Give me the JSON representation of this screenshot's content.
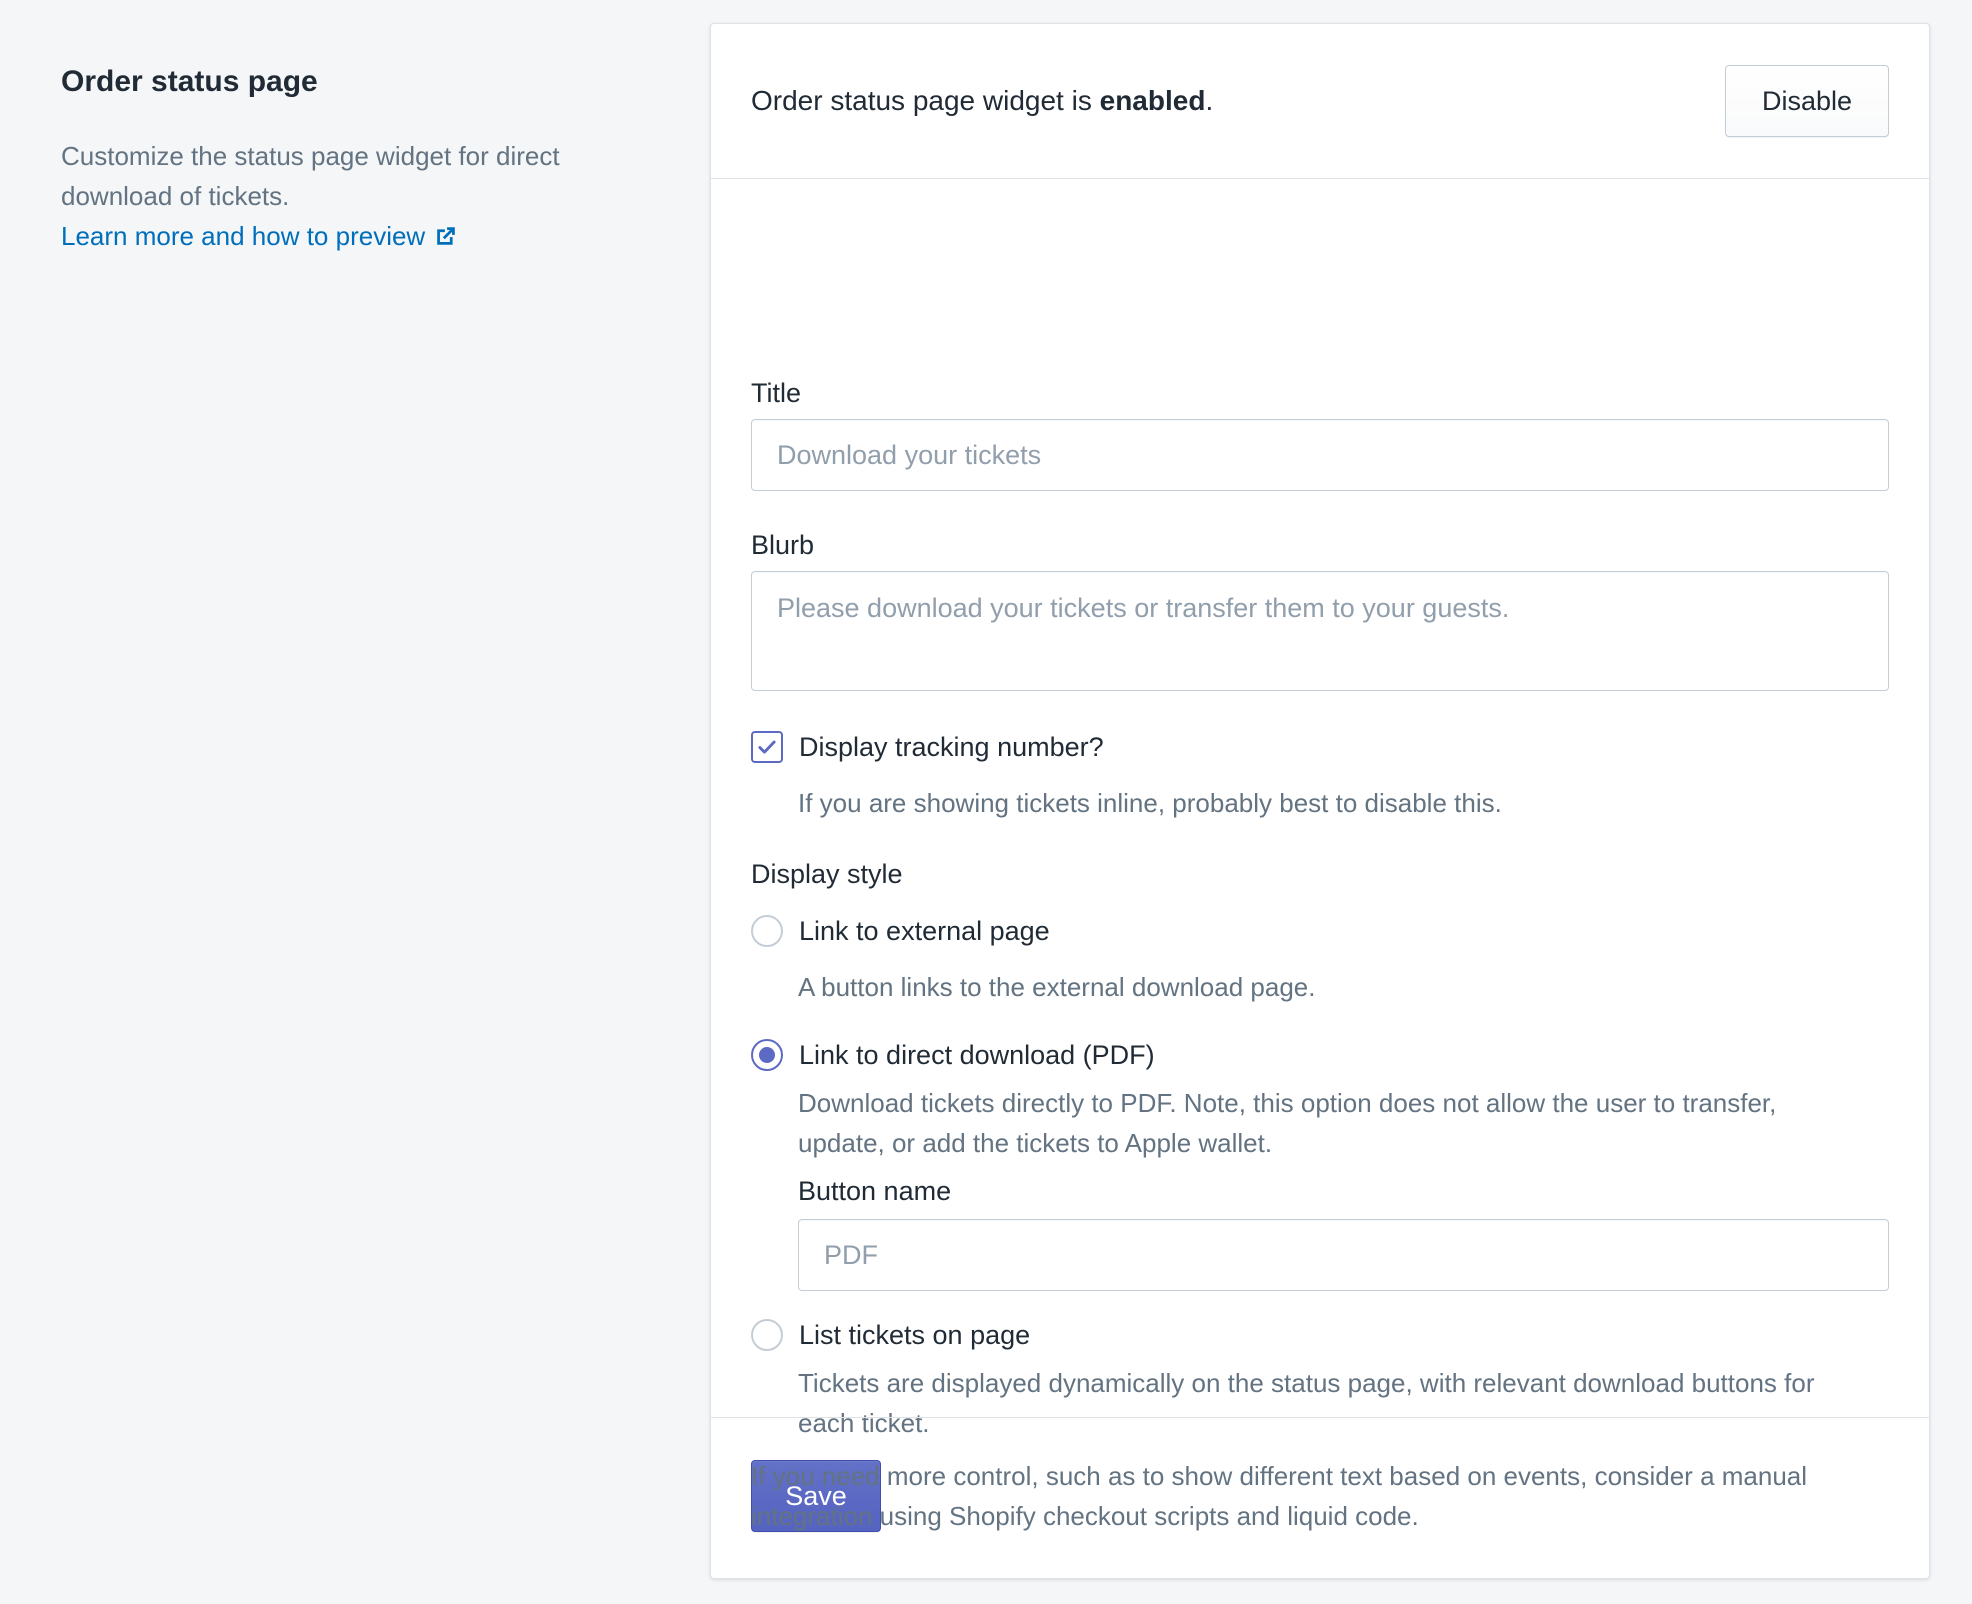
{
  "aside": {
    "title": "Order status page",
    "description": "Customize the status page widget for direct download of tickets.",
    "link_label": "Learn more and how to preview"
  },
  "header": {
    "status_prefix": "Order status page widget is ",
    "status_value": "enabled",
    "status_suffix": ".",
    "disable_label": "Disable"
  },
  "form": {
    "title_label": "Title",
    "title_placeholder": "Download your tickets",
    "blurb_label": "Blurb",
    "blurb_placeholder": "Please download your tickets or transfer them to your guests.",
    "tracking": {
      "label": "Display tracking number?",
      "help": "If you are showing tickets inline, probably best to disable this.",
      "checked": true
    },
    "display_style_label": "Display style",
    "options": [
      {
        "label": "Link to external page",
        "help": "A button links to the external download page.",
        "checked": false
      },
      {
        "label": "Link to direct download (PDF)",
        "help": "Download tickets directly to PDF. Note, this option does not allow the user to transfer, update, or add the tickets to Apple wallet.",
        "checked": true
      },
      {
        "label": "List tickets on page",
        "help": "Tickets are displayed dynamically on the status page, with relevant download buttons for each ticket.",
        "checked": false
      }
    ],
    "button_name_label": "Button name",
    "button_name_placeholder": "PDF",
    "save_label": "Save"
  },
  "footer": {
    "text": "If you need more control, such as to show different text based on events, consider a manual integration using Shopify checkout scripts and liquid code."
  },
  "colors": {
    "accent": "#5c6ac4",
    "link": "#006fbb",
    "muted_text": "#637381",
    "background": "#f4f6f8"
  },
  "icons": {
    "external_link": "external-link-icon",
    "checkmark": "checkmark-icon"
  }
}
